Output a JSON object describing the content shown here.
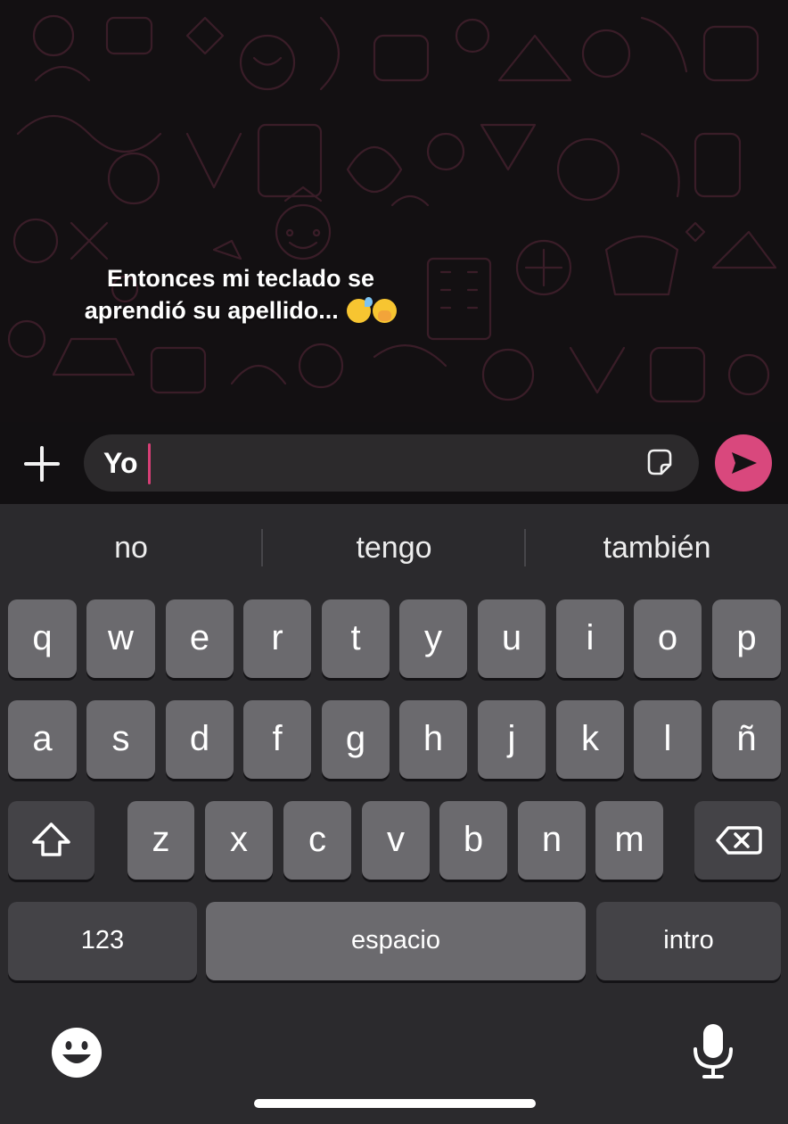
{
  "chat": {
    "caption_line1": "Entonces mi teclado se",
    "caption_line2": "aprendió su apellido...",
    "caption_emojis": [
      "grinning-face-with-sweat",
      "face-with-hand-over-mouth"
    ]
  },
  "composer": {
    "typed_text": "Yo",
    "accent_color": "#d9487d"
  },
  "keyboard": {
    "suggestions": [
      "no",
      "tengo",
      "también"
    ],
    "row1": [
      "q",
      "w",
      "e",
      "r",
      "t",
      "y",
      "u",
      "i",
      "o",
      "p"
    ],
    "row2": [
      "a",
      "s",
      "d",
      "f",
      "g",
      "h",
      "j",
      "k",
      "l",
      "ñ"
    ],
    "row3": [
      "z",
      "x",
      "c",
      "v",
      "b",
      "n",
      "m"
    ],
    "numbers_label": "123",
    "space_label": "espacio",
    "return_label": "intro"
  },
  "icons": {
    "plus": "plus-icon",
    "sticker": "sticker-icon",
    "send": "send-icon",
    "shift": "shift-icon",
    "backspace": "backspace-icon",
    "emoji": "emoji-icon",
    "microphone": "microphone-icon"
  }
}
